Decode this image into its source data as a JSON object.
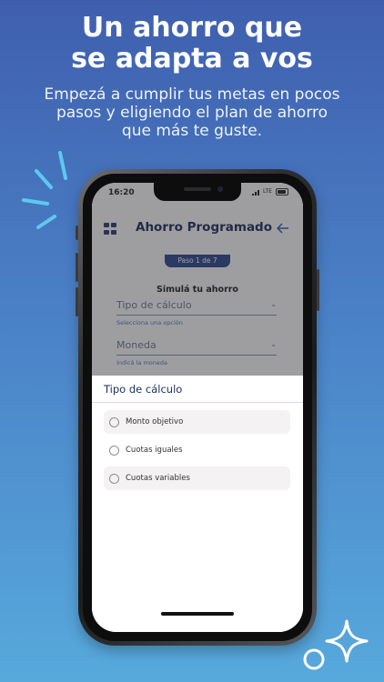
{
  "promo": {
    "headline_line1": "Un ahorro que",
    "headline_line2": "se adapta a vos",
    "sub_line1": "Empezá a cumplir tus metas en pocos",
    "sub_line2": "pasos y eligiendo el plan de ahorro",
    "sub_line3": "que más te guste."
  },
  "status_bar": {
    "time": "16:20",
    "network": "LTE"
  },
  "app": {
    "title": "Ahorro Programado",
    "back_icon": "arrow-left-icon",
    "menu_icon": "grid-menu-icon",
    "step": "Paso 1 de 7",
    "section_title": "Simulá tu ahorro",
    "fields": [
      {
        "label": "Tipo de cálculo",
        "help": "Selecciona una opción"
      },
      {
        "label": "Moneda",
        "help": "Indicá la moneda"
      }
    ]
  },
  "sheet": {
    "title": "Tipo de cálculo",
    "options": [
      {
        "label": "Monto objetivo"
      },
      {
        "label": "Cuotas iguales"
      },
      {
        "label": "Cuotas variables"
      }
    ]
  },
  "colors": {
    "brand": "#1f2d5a",
    "accent": "#2f4a8f",
    "link": "#2d5fb3"
  }
}
